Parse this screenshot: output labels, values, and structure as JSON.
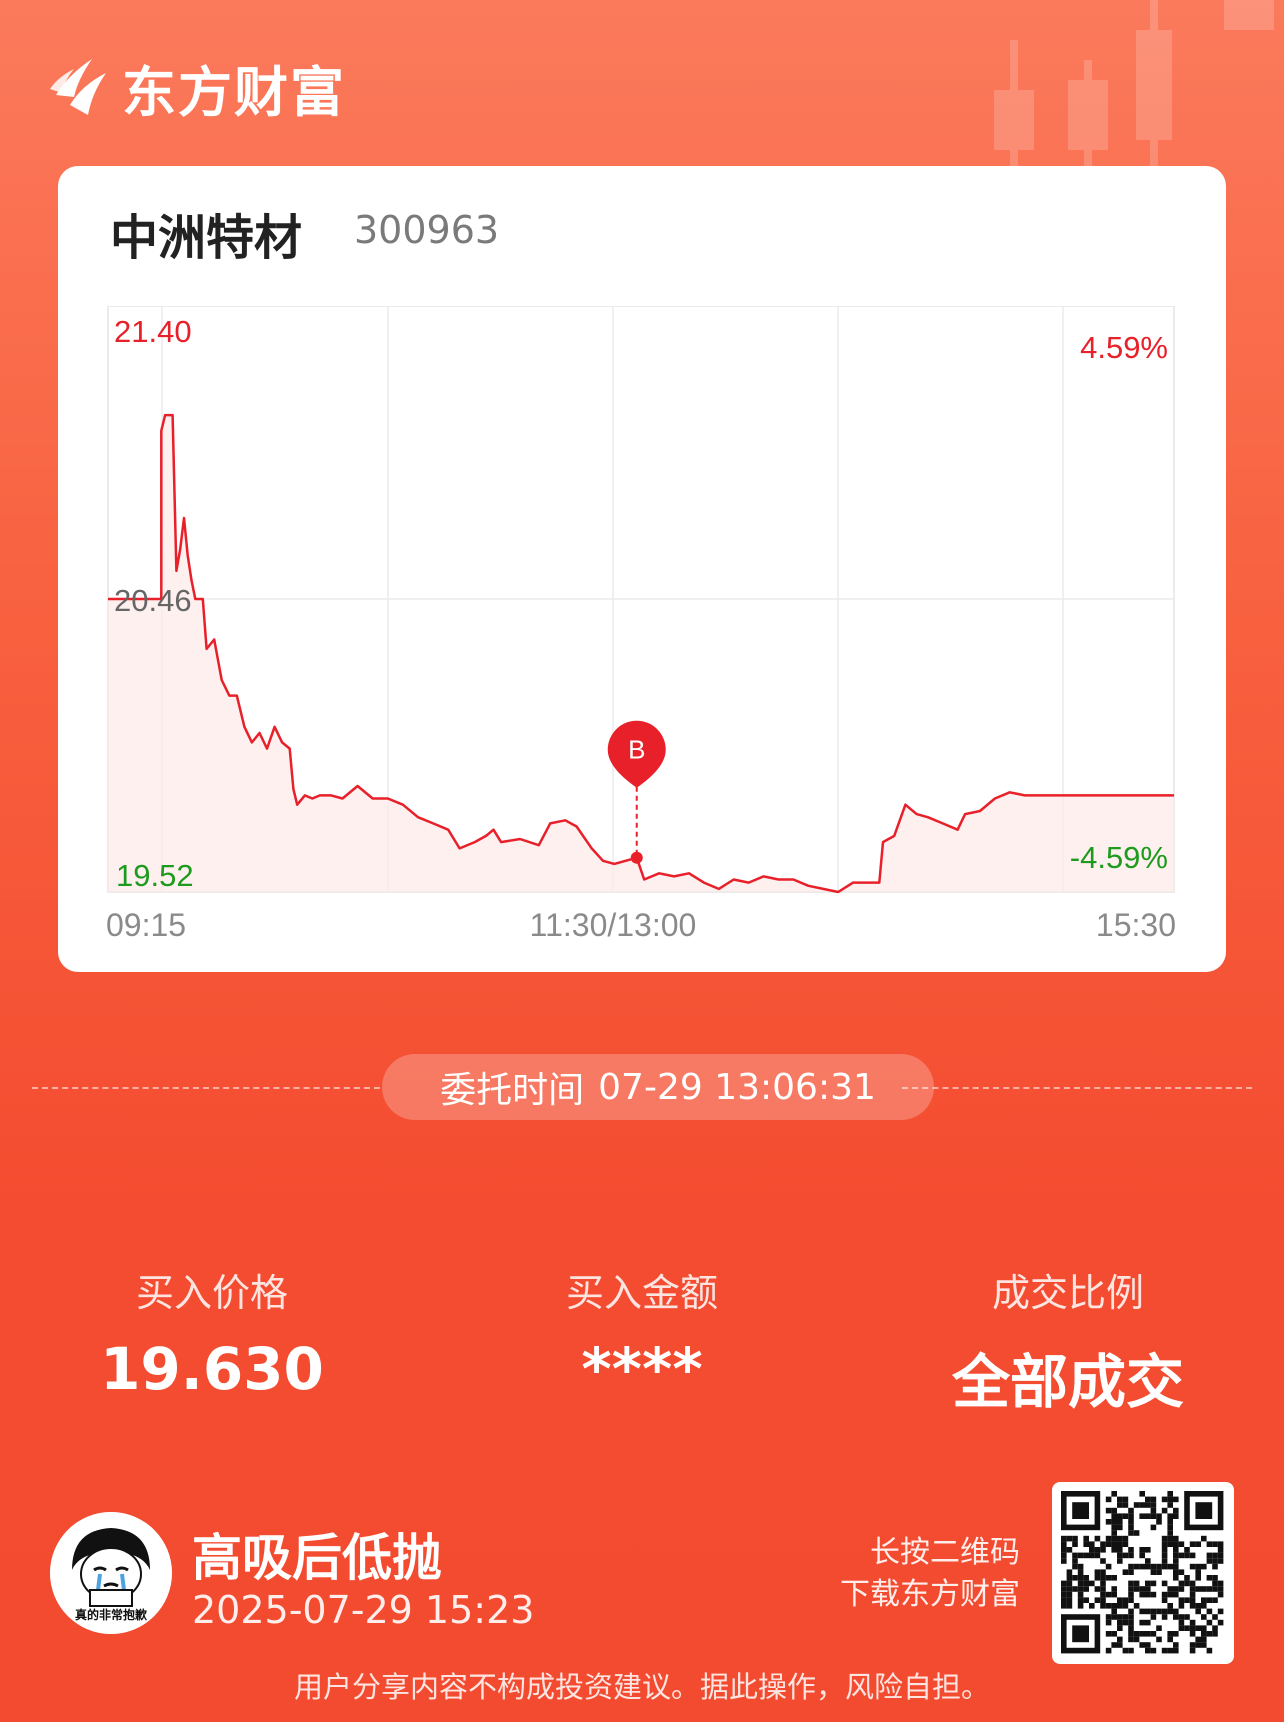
{
  "brand": {
    "name": "东方财富"
  },
  "stock": {
    "name": "中洲特材",
    "code": "300963"
  },
  "chart_data": {
    "type": "line",
    "price_high_label": "21.40",
    "price_mid_label": "20.46",
    "price_low_label": "19.52",
    "pct_high_label": "4.59%",
    "pct_low_label": "-4.59%",
    "x_labels": [
      "09:15",
      "11:30/13:00",
      "15:30"
    ],
    "ylim": [
      19.52,
      21.4
    ],
    "marker": {
      "label": "B",
      "time": "13:06",
      "price": 19.63
    },
    "series": [
      {
        "points": [
          [
            "09:15",
            20.46
          ],
          [
            "09:30",
            20.46
          ],
          [
            "09:30",
            21.0
          ],
          [
            "09:31",
            21.05
          ],
          [
            "09:33",
            21.05
          ],
          [
            "09:34",
            20.55
          ],
          [
            "09:35",
            20.62
          ],
          [
            "09:36",
            20.72
          ],
          [
            "09:37",
            20.6
          ],
          [
            "09:38",
            20.52
          ],
          [
            "09:39",
            20.46
          ],
          [
            "09:41",
            20.46
          ],
          [
            "09:42",
            20.3
          ],
          [
            "09:44",
            20.33
          ],
          [
            "09:46",
            20.2
          ],
          [
            "09:48",
            20.15
          ],
          [
            "09:50",
            20.15
          ],
          [
            "09:52",
            20.05
          ],
          [
            "09:54",
            20.0
          ],
          [
            "09:56",
            20.03
          ],
          [
            "09:58",
            19.98
          ],
          [
            "10:00",
            20.05
          ],
          [
            "10:02",
            20.0
          ],
          [
            "10:04",
            19.98
          ],
          [
            "10:05",
            19.85
          ],
          [
            "10:06",
            19.8
          ],
          [
            "10:08",
            19.83
          ],
          [
            "10:10",
            19.82
          ],
          [
            "10:12",
            19.83
          ],
          [
            "10:15",
            19.83
          ],
          [
            "10:18",
            19.82
          ],
          [
            "10:22",
            19.86
          ],
          [
            "10:26",
            19.82
          ],
          [
            "10:30",
            19.82
          ],
          [
            "10:34",
            19.8
          ],
          [
            "10:38",
            19.76
          ],
          [
            "10:42",
            19.74
          ],
          [
            "10:46",
            19.72
          ],
          [
            "10:49",
            19.66
          ],
          [
            "10:53",
            19.68
          ],
          [
            "10:56",
            19.7
          ],
          [
            "10:58",
            19.72
          ],
          [
            "11:00",
            19.68
          ],
          [
            "11:05",
            19.69
          ],
          [
            "11:10",
            19.67
          ],
          [
            "11:13",
            19.74
          ],
          [
            "11:17",
            19.75
          ],
          [
            "11:20",
            19.73
          ],
          [
            "11:24",
            19.66
          ],
          [
            "11:27",
            19.62
          ],
          [
            "11:30",
            19.61
          ],
          [
            "13:06",
            19.63
          ],
          [
            "13:08",
            19.56
          ],
          [
            "13:12",
            19.58
          ],
          [
            "13:16",
            19.57
          ],
          [
            "13:20",
            19.58
          ],
          [
            "13:24",
            19.55
          ],
          [
            "13:28",
            19.53
          ],
          [
            "13:32",
            19.56
          ],
          [
            "13:36",
            19.55
          ],
          [
            "13:40",
            19.57
          ],
          [
            "13:44",
            19.56
          ],
          [
            "13:48",
            19.56
          ],
          [
            "13:52",
            19.54
          ],
          [
            "13:56",
            19.53
          ],
          [
            "14:00",
            19.52
          ],
          [
            "14:04",
            19.55
          ],
          [
            "14:08",
            19.55
          ],
          [
            "14:11",
            19.55
          ],
          [
            "14:12",
            19.68
          ],
          [
            "14:15",
            19.7
          ],
          [
            "14:18",
            19.8
          ],
          [
            "14:21",
            19.77
          ],
          [
            "14:24",
            19.76
          ],
          [
            "14:28",
            19.74
          ],
          [
            "14:32",
            19.72
          ],
          [
            "14:34",
            19.77
          ],
          [
            "14:38",
            19.78
          ],
          [
            "14:42",
            19.82
          ],
          [
            "14:46",
            19.84
          ],
          [
            "14:50",
            19.83
          ],
          [
            "15:00",
            19.83
          ],
          [
            "15:30",
            19.83
          ]
        ]
      }
    ]
  },
  "order": {
    "label": "委托时间",
    "time": "07-29 13:06:31"
  },
  "stats": [
    {
      "label": "买入价格",
      "value": "19.630"
    },
    {
      "label": "买入金额",
      "value": "****"
    },
    {
      "label": "成交比例",
      "value": "全部成交"
    }
  ],
  "user": {
    "name": "高吸后低抛",
    "time": "2025-07-29 15:23",
    "avatar_caption": "真的非常抱歉"
  },
  "qr": {
    "line1": "长按二维码",
    "line2": "下载东方财富"
  },
  "disclaimer": "用户分享内容不构成投资建议。据此操作，风险自担。",
  "colors": {
    "up": "#e8202a",
    "down": "#1e9a1e",
    "neutral": "#666666",
    "accent": "#f24b2f"
  }
}
